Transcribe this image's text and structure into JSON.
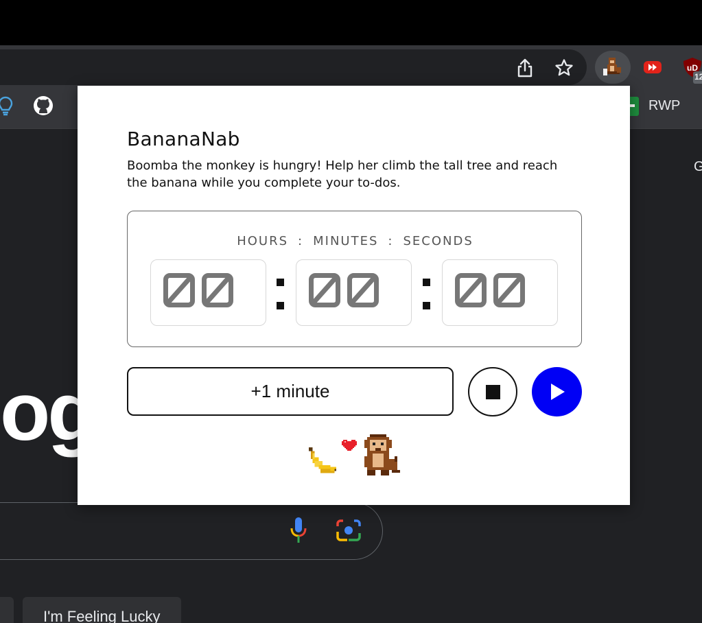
{
  "browser": {
    "extension_badge": "12",
    "bookmarks": {
      "rwp_label": "RWP"
    }
  },
  "page_behind": {
    "logo_fragment": "og",
    "corner_text": "G",
    "feeling_lucky_label": "I'm Feeling Lucky"
  },
  "popup": {
    "title": "BananaNab",
    "description": "Boomba the monkey is hungry! Help her climb the tall tree and reach the banana while you complete your to-dos.",
    "units": {
      "hours": "HOURS",
      "minutes": "MINUTES",
      "seconds": "SECONDS",
      "separator": ":"
    },
    "timer": {
      "hours": "00",
      "minutes": "00",
      "seconds": "00"
    },
    "add_minute_label": "+1 minute",
    "stop_label": "stop",
    "start_label": "start"
  },
  "colors": {
    "start_button": "#0000f5",
    "digit": "#777777",
    "chrome_toolbar": "#35363a",
    "page_bg": "#202124"
  },
  "icons": [
    "share-icon",
    "star-icon",
    "monkey-extension-icon",
    "youtube-extension-icon",
    "ublock-extension-icon",
    "lightbulb-icon",
    "github-icon",
    "green-bookmark-icon",
    "mic-icon",
    "lens-camera-icon",
    "stop-icon",
    "play-icon",
    "banana-icon",
    "heart-icon",
    "monkey-icon"
  ]
}
